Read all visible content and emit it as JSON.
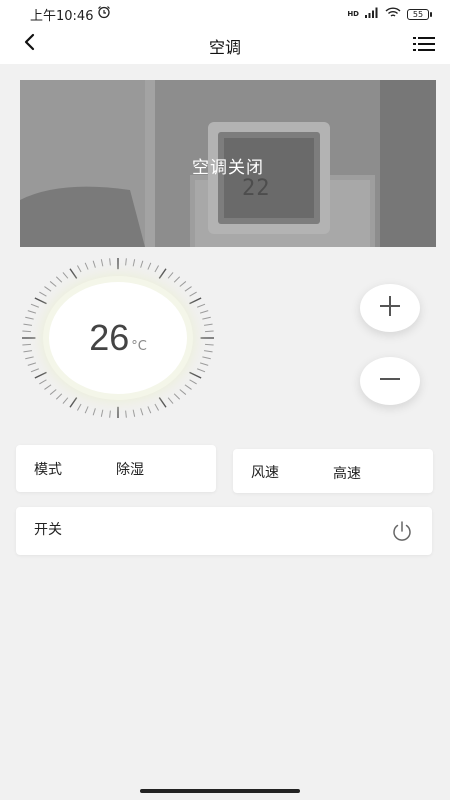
{
  "status_bar": {
    "time": "上午10:46",
    "network": "HD",
    "battery": "55"
  },
  "nav": {
    "title": "空调"
  },
  "banner": {
    "caption": "空调关闭",
    "display_reading": "22"
  },
  "thermostat": {
    "temperature": "26",
    "unit": "°C"
  },
  "mode": {
    "label": "模式",
    "value": "除湿"
  },
  "wind": {
    "label": "风速",
    "value": "高速"
  },
  "power": {
    "label": "开关"
  },
  "icons": {
    "back": "chevron-left-icon",
    "menu": "list-menu-icon",
    "plus": "plus-icon",
    "minus": "minus-icon",
    "power": "power-icon",
    "alarm": "alarm-clock-icon",
    "signal": "signal-icon",
    "wifi": "wifi-icon",
    "battery": "battery-icon"
  },
  "colors": {
    "background": "#f1f1f1",
    "card": "#ffffff",
    "dial_glow": "#eceed8",
    "text": "#222222"
  }
}
